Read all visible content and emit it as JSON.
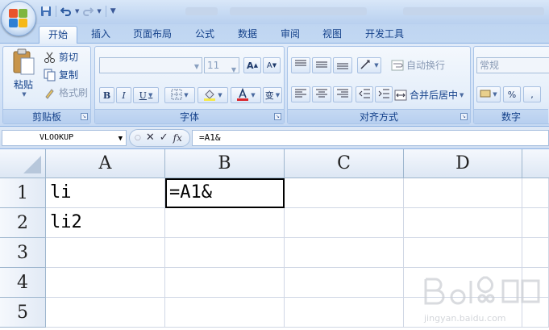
{
  "quick_access": {
    "icons": [
      "save-icon",
      "undo-icon",
      "redo-icon",
      "customize-qat-icon"
    ]
  },
  "tabs": [
    {
      "label": "开始",
      "active": true
    },
    {
      "label": "插入"
    },
    {
      "label": "页面布局"
    },
    {
      "label": "公式"
    },
    {
      "label": "数据"
    },
    {
      "label": "审阅"
    },
    {
      "label": "视图"
    },
    {
      "label": "开发工具"
    }
  ],
  "ribbon": {
    "clipboard": {
      "title": "剪贴板",
      "paste": "粘贴",
      "cut": "剪切",
      "copy": "复制",
      "format_painter": "格式刷"
    },
    "font": {
      "title": "字体",
      "font_name": "",
      "font_size": "11",
      "bold": "B",
      "italic": "I",
      "underline": "U",
      "increase": "A",
      "decrease": "A",
      "phonetic": "变"
    },
    "alignment": {
      "title": "对齐方式",
      "wrap_text": "自动换行",
      "merge_center": "合并后居中"
    },
    "number": {
      "title": "数字",
      "format": "常规",
      "percent": "%",
      "comma": ","
    }
  },
  "formula_bar": {
    "name_box": "VLOOKUP",
    "fx": "fx",
    "formula": "=A1&"
  },
  "grid": {
    "columns": [
      "A",
      "B",
      "C",
      "D"
    ],
    "rows": [
      "1",
      "2",
      "3",
      "4",
      "5"
    ],
    "cells": {
      "A1": "li",
      "B1": "=A1&",
      "A2": "li2"
    }
  },
  "colors": {
    "ribbon_bg": "#d4e3f7",
    "tab_text": "#15428b",
    "grid_line": "#d0d7e5"
  }
}
